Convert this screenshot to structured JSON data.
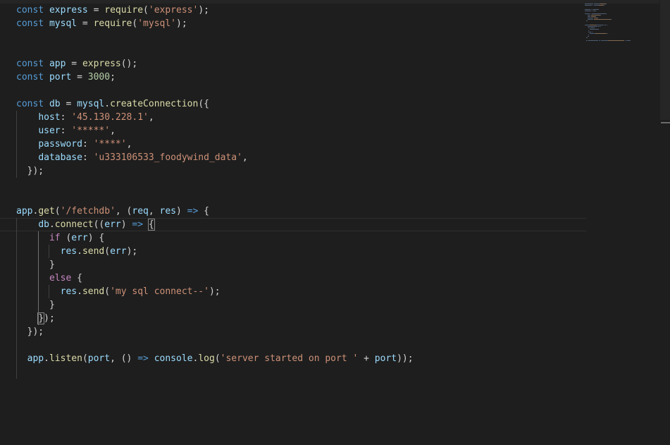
{
  "editor": {
    "lines": [
      [
        {
          "t": "const",
          "c": "kw-storage"
        },
        {
          "t": " "
        },
        {
          "t": "express",
          "c": "var"
        },
        {
          "t": " = "
        },
        {
          "t": "require",
          "c": "fn"
        },
        {
          "t": "("
        },
        {
          "t": "'express'",
          "c": "str"
        },
        {
          "t": ");"
        }
      ],
      [
        {
          "t": "const",
          "c": "kw-storage"
        },
        {
          "t": " "
        },
        {
          "t": "mysql",
          "c": "var"
        },
        {
          "t": " = "
        },
        {
          "t": "require",
          "c": "fn"
        },
        {
          "t": "("
        },
        {
          "t": "'mysql'",
          "c": "str"
        },
        {
          "t": ");"
        }
      ],
      [],
      [],
      [
        {
          "t": "const",
          "c": "kw-storage"
        },
        {
          "t": " "
        },
        {
          "t": "app",
          "c": "var"
        },
        {
          "t": " = "
        },
        {
          "t": "express",
          "c": "fn"
        },
        {
          "t": "();"
        }
      ],
      [
        {
          "t": "const",
          "c": "kw-storage"
        },
        {
          "t": " "
        },
        {
          "t": "port",
          "c": "var"
        },
        {
          "t": " = "
        },
        {
          "t": "3000",
          "c": "num"
        },
        {
          "t": ";"
        }
      ],
      [],
      [
        {
          "t": "const",
          "c": "kw-storage"
        },
        {
          "t": " "
        },
        {
          "t": "db",
          "c": "var"
        },
        {
          "t": " = "
        },
        {
          "t": "mysql",
          "c": "var"
        },
        {
          "t": "."
        },
        {
          "t": "createConnection",
          "c": "fn"
        },
        {
          "t": "({"
        }
      ],
      [
        {
          "t": "    "
        },
        {
          "t": "host",
          "c": "prop"
        },
        {
          "t": ": "
        },
        {
          "t": "'45.130.228.1'",
          "c": "str"
        },
        {
          "t": ","
        }
      ],
      [
        {
          "t": "    "
        },
        {
          "t": "user",
          "c": "prop"
        },
        {
          "t": ": "
        },
        {
          "t": "'*****'",
          "c": "str"
        },
        {
          "t": ","
        }
      ],
      [
        {
          "t": "    "
        },
        {
          "t": "password",
          "c": "prop"
        },
        {
          "t": ": "
        },
        {
          "t": "'****'",
          "c": "str"
        },
        {
          "t": ","
        }
      ],
      [
        {
          "t": "    "
        },
        {
          "t": "database",
          "c": "prop"
        },
        {
          "t": ": "
        },
        {
          "t": "'u333106533_foodywind_data'",
          "c": "str"
        },
        {
          "t": ","
        }
      ],
      [
        {
          "t": "  });"
        }
      ],
      [],
      [],
      [
        {
          "t": "app",
          "c": "var"
        },
        {
          "t": "."
        },
        {
          "t": "get",
          "c": "fn"
        },
        {
          "t": "("
        },
        {
          "t": "'/fetchdb'",
          "c": "str"
        },
        {
          "t": ", ("
        },
        {
          "t": "req",
          "c": "var"
        },
        {
          "t": ", "
        },
        {
          "t": "res",
          "c": "var"
        },
        {
          "t": ") "
        },
        {
          "t": "=>",
          "c": "arrow"
        },
        {
          "t": " {"
        }
      ],
      [
        {
          "t": "    "
        },
        {
          "t": "db",
          "c": "var"
        },
        {
          "t": "."
        },
        {
          "t": "connect",
          "c": "fn"
        },
        {
          "t": "(("
        },
        {
          "t": "err",
          "c": "var"
        },
        {
          "t": ") "
        },
        {
          "t": "=>",
          "c": "arrow"
        },
        {
          "t": " "
        },
        {
          "t": "{",
          "m": true
        }
      ],
      [
        {
          "t": "      "
        },
        {
          "t": "if",
          "c": "kw-control"
        },
        {
          "t": " ("
        },
        {
          "t": "err",
          "c": "var"
        },
        {
          "t": ") {"
        }
      ],
      [
        {
          "t": "        "
        },
        {
          "t": "res",
          "c": "var"
        },
        {
          "t": "."
        },
        {
          "t": "send",
          "c": "fn"
        },
        {
          "t": "("
        },
        {
          "t": "err",
          "c": "var"
        },
        {
          "t": ");"
        }
      ],
      [
        {
          "t": "      }"
        }
      ],
      [
        {
          "t": "      "
        },
        {
          "t": "else",
          "c": "kw-control"
        },
        {
          "t": " {"
        }
      ],
      [
        {
          "t": "        "
        },
        {
          "t": "res",
          "c": "var"
        },
        {
          "t": "."
        },
        {
          "t": "send",
          "c": "fn"
        },
        {
          "t": "("
        },
        {
          "t": "'my sql connect--'",
          "c": "str"
        },
        {
          "t": ");"
        }
      ],
      [
        {
          "t": "      }"
        }
      ],
      [
        {
          "t": "    "
        },
        {
          "t": "}",
          "m": true
        },
        {
          "t": ");"
        }
      ],
      [
        {
          "t": "  });"
        }
      ],
      [],
      [
        {
          "t": "  "
        },
        {
          "t": "app",
          "c": "var"
        },
        {
          "t": "."
        },
        {
          "t": "listen",
          "c": "fn"
        },
        {
          "t": "("
        },
        {
          "t": "port",
          "c": "var"
        },
        {
          "t": ", () "
        },
        {
          "t": "=>",
          "c": "arrow"
        },
        {
          "t": " "
        },
        {
          "t": "console",
          "c": "var"
        },
        {
          "t": "."
        },
        {
          "t": "log",
          "c": "fn"
        },
        {
          "t": "("
        },
        {
          "t": "'server started on port '",
          "c": "str"
        },
        {
          "t": " + "
        },
        {
          "t": "port",
          "c": "var"
        },
        {
          "t": "));"
        }
      ],
      []
    ],
    "current_line": 16
  },
  "colors": {
    "background": "#1e1e1e",
    "keyword": "#569cd6",
    "control": "#c586c0",
    "variable": "#9cdcfe",
    "function": "#dcdcaa",
    "string": "#ce9178",
    "number": "#b5cea8"
  }
}
